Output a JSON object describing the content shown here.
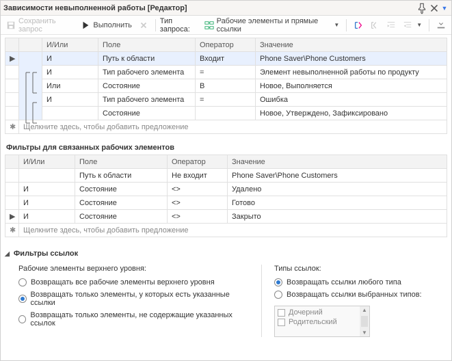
{
  "title": "Зависимости невыполненной работы [Редактор]",
  "toolbar": {
    "save": "Сохранить запрос",
    "run": "Выполнить",
    "query_type_label": "Тип запроса:",
    "query_type_value": "Рабочие элементы и прямые ссылки"
  },
  "grid1": {
    "headers": {
      "andor": "И/Или",
      "field": "Поле",
      "op": "Оператор",
      "val": "Значение"
    },
    "rows": [
      {
        "indicator": "▶",
        "andor": "И",
        "field": "Путь к области",
        "op": "Входит",
        "val": "Phone Saver\\Phone Customers"
      },
      {
        "indicator": "",
        "andor": "И",
        "field": "Тип рабочего элемента",
        "op": "=",
        "val": "Элемент невыполненной работы по продукту"
      },
      {
        "indicator": "",
        "andor": "Или",
        "field": "Состояние",
        "op": "В",
        "val": "Новое, Выполняется"
      },
      {
        "indicator": "",
        "andor": "И",
        "field": "Тип рабочего элемента",
        "op": "=",
        "val": "Ошибка"
      },
      {
        "indicator": "",
        "andor": "",
        "field": "Состояние",
        "op": "",
        "val": "Новое, Утверждено, Зафиксировано"
      }
    ],
    "placeholder": "Щелкните здесь, чтобы добавить предложение"
  },
  "grid2_heading": "Фильтры для связанных рабочих элементов",
  "grid2": {
    "headers": {
      "andor": "И/Или",
      "field": "Поле",
      "op": "Оператор",
      "val": "Значение"
    },
    "rows": [
      {
        "indicator": "",
        "andor": "",
        "field": "Путь к области",
        "op": "Не входит",
        "val": "Phone Saver\\Phone Customers"
      },
      {
        "indicator": "",
        "andor": "И",
        "field": "Состояние",
        "op": "<>",
        "val": "Удалено"
      },
      {
        "indicator": "",
        "andor": "И",
        "field": "Состояние",
        "op": "<>",
        "val": "Готово"
      },
      {
        "indicator": "▶",
        "andor": "И",
        "field": "Состояние",
        "op": "<>",
        "val": "Закрыто"
      }
    ],
    "placeholder": "Щелкните здесь, чтобы добавить предложение"
  },
  "filters": {
    "heading": "Фильтры ссылок",
    "left_heading": "Рабочие элементы верхнего уровня:",
    "left_options": [
      {
        "label": "Возвращать все рабочие элементы верхнего уровня",
        "checked": false
      },
      {
        "label": "Возвращать только элементы, у которых есть указанные ссылки",
        "checked": true
      },
      {
        "label": "Возвращать только элементы, не содержащие указанных ссылок",
        "checked": false
      }
    ],
    "right_heading": "Типы ссылок:",
    "right_options": [
      {
        "label": "Возвращать ссылки любого типа",
        "checked": true
      },
      {
        "label": "Возвращать ссылки выбранных типов:",
        "checked": false
      }
    ],
    "types": [
      "Дочерний",
      "Родительский"
    ]
  }
}
